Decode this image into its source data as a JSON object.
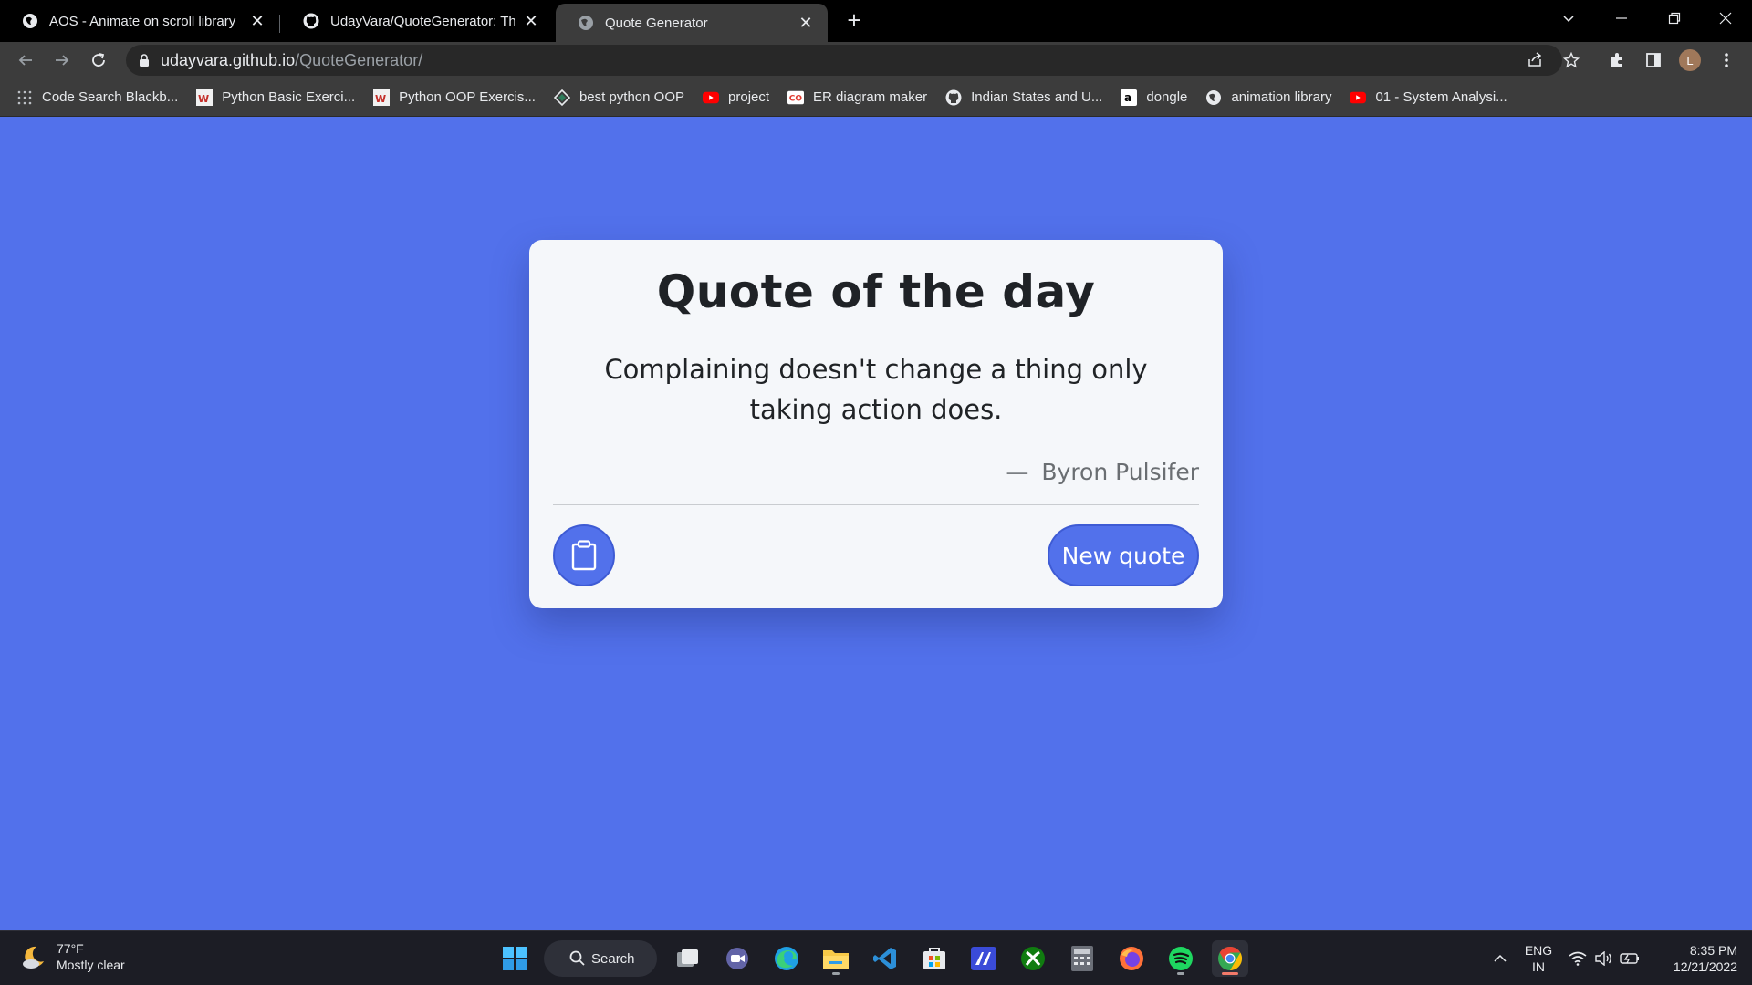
{
  "browser": {
    "tabs": [
      {
        "title": "AOS - Animate on scroll library",
        "favicon": "globe-icon"
      },
      {
        "title": "UdayVara/QuoteGenerator: This i",
        "favicon": "github-icon"
      },
      {
        "title": "Quote Generator",
        "favicon": "globe-icon",
        "active": true
      }
    ],
    "url_host": "udayvara.github.io",
    "url_path": "/QuoteGenerator/",
    "profile_initial": "L"
  },
  "bookmarks": [
    {
      "label": "Code Search Blackb...",
      "icon": "dots-icon"
    },
    {
      "label": "Python Basic Exerci...",
      "icon": "w3resource-icon"
    },
    {
      "label": "Python OOP Exercis...",
      "icon": "w3resource-icon"
    },
    {
      "label": "best python OOP",
      "icon": "diamond-icon"
    },
    {
      "label": "project",
      "icon": "youtube-icon"
    },
    {
      "label": "ER diagram maker",
      "icon": "cc-icon"
    },
    {
      "label": "Indian States and U...",
      "icon": "github-icon"
    },
    {
      "label": "dongle",
      "icon": "amazon-icon"
    },
    {
      "label": "animation library",
      "icon": "globe-icon"
    },
    {
      "label": "01 - System Analysi...",
      "icon": "youtube-icon"
    }
  ],
  "card": {
    "title": "Quote of the day",
    "quote": "Complaining doesn't change a thing only taking action does.",
    "author_dash": "—",
    "author": "Byron Pulsifer",
    "new_quote_label": "New quote",
    "accent": "#5271eb"
  },
  "taskbar": {
    "temperature": "77°F",
    "weather": "Mostly clear",
    "search_label": "Search",
    "language": "ENG",
    "region": "IN",
    "time": "8:35 PM",
    "date": "12/21/2022"
  }
}
